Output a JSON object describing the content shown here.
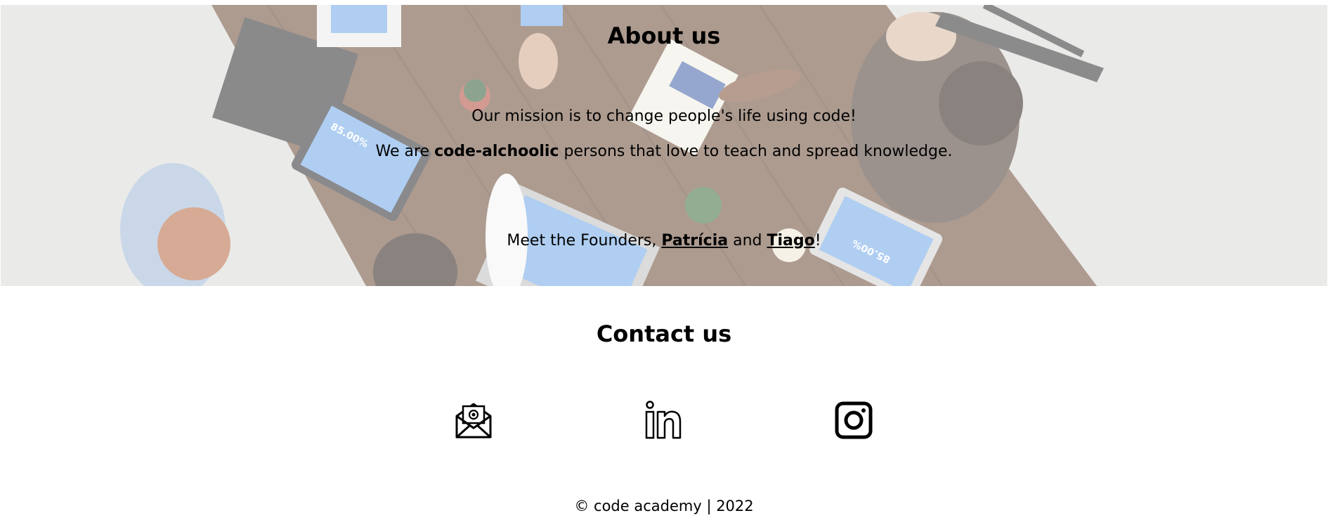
{
  "about": {
    "title": "About us",
    "mission": "Our mission is to change people's life using code!",
    "alcoholic_prefix": "We are ",
    "alcoholic_bold": "code-alchoolic",
    "alcoholic_suffix": " persons that love to teach and spread knowledge.",
    "founders_prefix": "Meet the Founders, ",
    "founder_1": "Patrícia",
    "founders_middle": " and ",
    "founder_2": "Tiago",
    "founders_suffix": "!",
    "laptop_left_text": "85.00%",
    "laptop_right_text": "85.00%"
  },
  "contact": {
    "title": "Contact us",
    "icons": [
      "email-icon",
      "linkedin-icon",
      "instagram-icon"
    ]
  },
  "footer": {
    "text": "© code academy | 2022"
  },
  "colors": {
    "overlay": "#ffffff",
    "table": "#6b4a35",
    "floor": "#dcdcd8",
    "screen": "#6ea6e8"
  }
}
